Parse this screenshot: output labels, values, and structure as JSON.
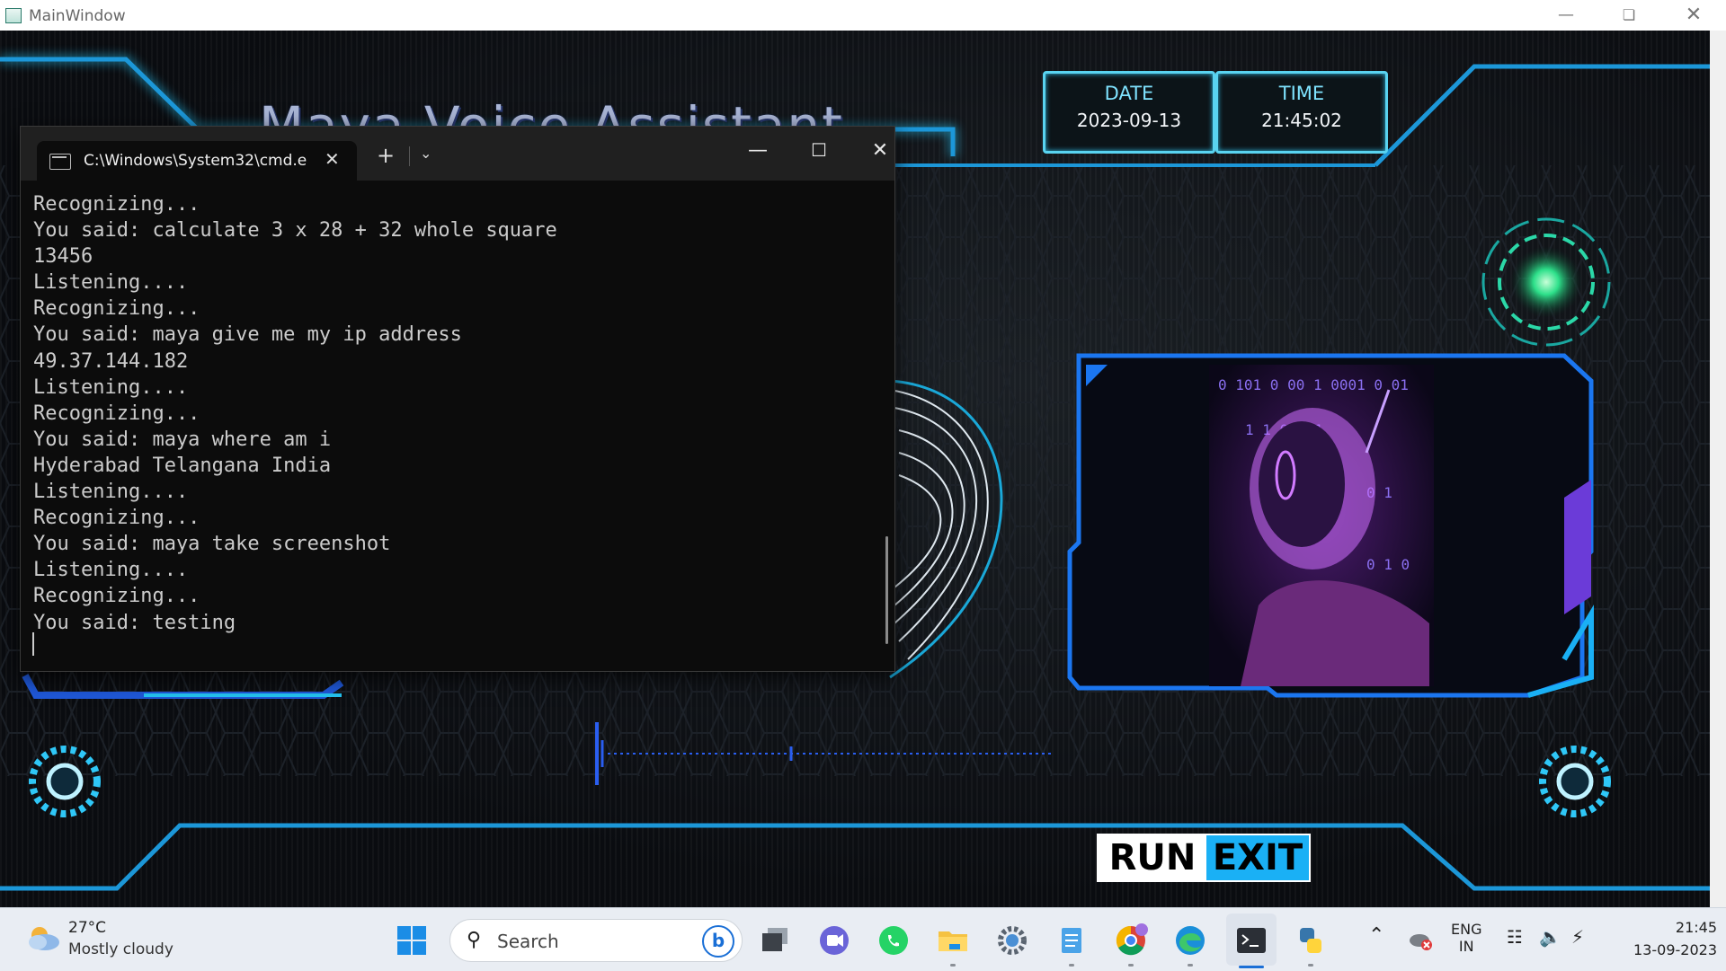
{
  "window": {
    "title": "MainWindow",
    "minimize_icon": "minimize-icon",
    "maximize_icon": "restore-icon",
    "close_icon": "close-icon"
  },
  "app": {
    "title": "Maya Voice Assistant",
    "date_label": "DATE",
    "date_value": "2023-09-13",
    "time_label": "TIME",
    "time_value": "21:45:02",
    "run_label": "RUN",
    "exit_label": "EXIT",
    "accent_color": "#1ab0f5",
    "glow_color": "#26c6f6"
  },
  "cmd": {
    "tab_title": "C:\\Windows\\System32\\cmd.e",
    "lines": [
      "Recognizing...",
      "You said: calculate 3 x 28 + 32 whole square",
      "13456",
      "Listening....",
      "Recognizing...",
      "You said: maya give me my ip address",
      "49.37.144.182",
      "Listening....",
      "Recognizing...",
      "You said: maya where am i",
      "Hyderabad Telangana India",
      "Listening....",
      "Recognizing...",
      "You said: maya take screenshot",
      "Listening....",
      "Recognizing...",
      "You said: testing"
    ]
  },
  "taskbar": {
    "weather_temp": "27°C",
    "weather_desc": "Mostly cloudy",
    "search_placeholder": "Search",
    "lang_top": "ENG",
    "lang_bottom": "IN",
    "clock_time": "21:45",
    "clock_date": "13-09-2023",
    "pinned": [
      "start-icon",
      "task-view-icon",
      "teams-icon",
      "whatsapp-icon",
      "file-explorer-icon",
      "settings-icon",
      "notepad-icon",
      "chrome-icon",
      "edge-icon",
      "terminal-icon",
      "python-icon"
    ]
  }
}
